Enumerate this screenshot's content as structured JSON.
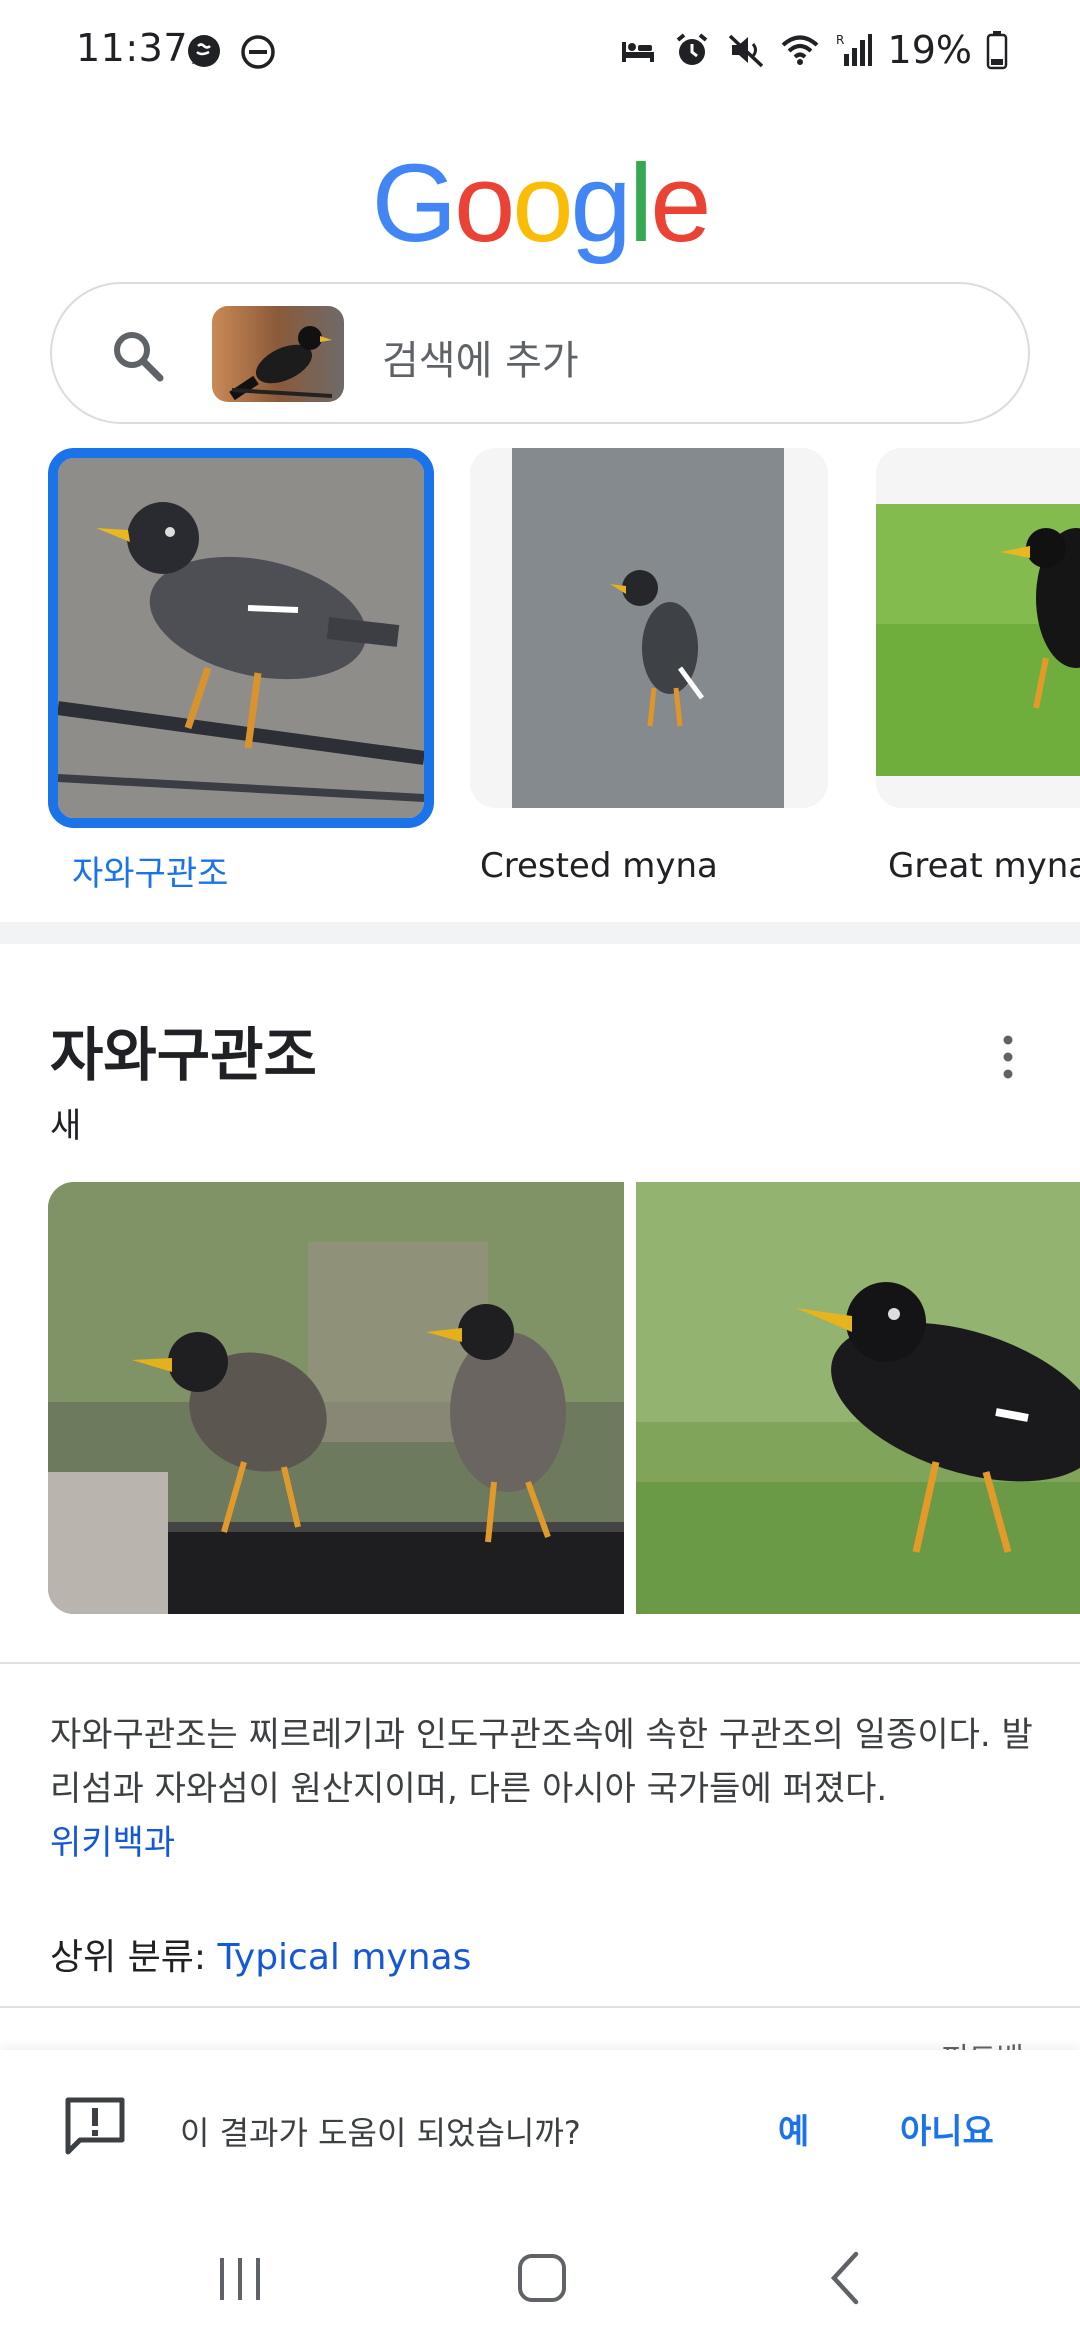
{
  "status_bar": {
    "time": "11:37",
    "battery_percent": "19%",
    "left_icons": [
      "chat-bubble-icon",
      "do-not-disturb-icon"
    ],
    "right_icons": [
      "bed-icon",
      "alarm-icon",
      "mute-icon",
      "wifi-icon",
      "signal-icon",
      "battery-icon"
    ]
  },
  "logo": {
    "letters": [
      "G",
      "o",
      "o",
      "g",
      "l",
      "e"
    ],
    "colors": [
      "#4285F4",
      "#EA4335",
      "#FBBC05",
      "#4285F4",
      "#34A853",
      "#EA4335"
    ]
  },
  "search": {
    "placeholder": "검색에 추가",
    "icon": "search-icon"
  },
  "matches": [
    {
      "label": "자와구관조",
      "selected": true
    },
    {
      "label": "Crested myna",
      "selected": false
    },
    {
      "label": "Great myna",
      "selected": false
    }
  ],
  "knowledge_panel": {
    "title": "자와구관조",
    "subtitle": "새",
    "description": "자와구관조는 찌르레기과 인도구관조속에 속한 구관조의 일종이다. 발리섬과 자와섬이 원산지이며, 다른 아시아 국가들에 퍼졌다.",
    "source_link": "위키백과",
    "parent_label": "상위 분류: ",
    "parent_link": "Typical mynas",
    "feedback_peek": "피드백"
  },
  "feedback_bar": {
    "question": "이 결과가 도움이 되었습니까?",
    "yes": "예",
    "no": "아니요"
  },
  "nav_bar": {
    "buttons": [
      "recent-apps-icon",
      "home-icon",
      "back-icon"
    ]
  },
  "colors": {
    "accent": "#1a73e8",
    "link": "#1558d6"
  }
}
